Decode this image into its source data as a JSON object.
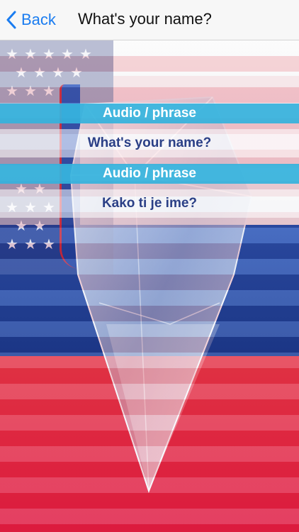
{
  "nav": {
    "back_label": "Back",
    "title": "What's your name?"
  },
  "phrases": [
    {
      "audio_label": "Audio / phrase",
      "text": "What's your name?"
    },
    {
      "audio_label": "Audio / phrase",
      "text": "Kako ti je ime?"
    }
  ],
  "colors": {
    "accent": "#1a7cf0",
    "audio_bar": "#34b2dc",
    "phrase_text": "#2a3f86",
    "flag_blue": "#1f44a8",
    "flag_red": "#e01f47"
  },
  "icons": {
    "back": "chevron-left-icon"
  }
}
